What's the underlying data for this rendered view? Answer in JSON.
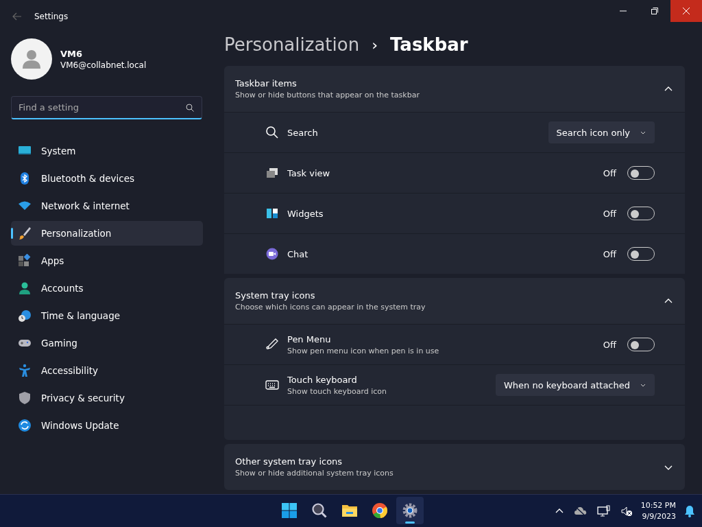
{
  "window": {
    "title": "Settings"
  },
  "account": {
    "name": "VM6",
    "email": "VM6@collabnet.local"
  },
  "search": {
    "placeholder": "Find a setting"
  },
  "sidebar": {
    "items": [
      {
        "label": "System",
        "selected": false
      },
      {
        "label": "Bluetooth & devices",
        "selected": false
      },
      {
        "label": "Network & internet",
        "selected": false
      },
      {
        "label": "Personalization",
        "selected": true
      },
      {
        "label": "Apps",
        "selected": false
      },
      {
        "label": "Accounts",
        "selected": false
      },
      {
        "label": "Time & language",
        "selected": false
      },
      {
        "label": "Gaming",
        "selected": false
      },
      {
        "label": "Accessibility",
        "selected": false
      },
      {
        "label": "Privacy & security",
        "selected": false
      },
      {
        "label": "Windows Update",
        "selected": false
      }
    ]
  },
  "breadcrumb": {
    "parent": "Personalization",
    "separator": "›",
    "current": "Taskbar"
  },
  "sections": [
    {
      "title": "Taskbar items",
      "subtitle": "Show or hide buttons that appear on the taskbar",
      "expanded": true,
      "rows": [
        {
          "kind": "dropdown",
          "label": "Search",
          "value": "Search icon only"
        },
        {
          "kind": "toggle",
          "label": "Task view",
          "state_label": "Off",
          "on": false
        },
        {
          "kind": "toggle",
          "label": "Widgets",
          "state_label": "Off",
          "on": false
        },
        {
          "kind": "toggle",
          "label": "Chat",
          "state_label": "Off",
          "on": false
        }
      ]
    },
    {
      "title": "System tray icons",
      "subtitle": "Choose which icons can appear in the system tray",
      "expanded": true,
      "rows": [
        {
          "kind": "toggle",
          "label": "Pen Menu",
          "description": "Show pen menu icon when pen is in use",
          "state_label": "Off",
          "on": false
        },
        {
          "kind": "dropdown",
          "label": "Touch keyboard",
          "description": "Show touch keyboard icon",
          "value": "When no keyboard attached"
        }
      ]
    },
    {
      "title": "Other system tray icons",
      "subtitle": "Show or hide additional system tray icons",
      "expanded": false
    }
  ],
  "taskbar": {
    "apps": [
      {
        "selected": false
      },
      {
        "selected": false
      },
      {
        "selected": false
      },
      {
        "selected": false
      },
      {
        "selected": true
      }
    ],
    "time": "10:52 PM",
    "date": "9/9/2023"
  }
}
